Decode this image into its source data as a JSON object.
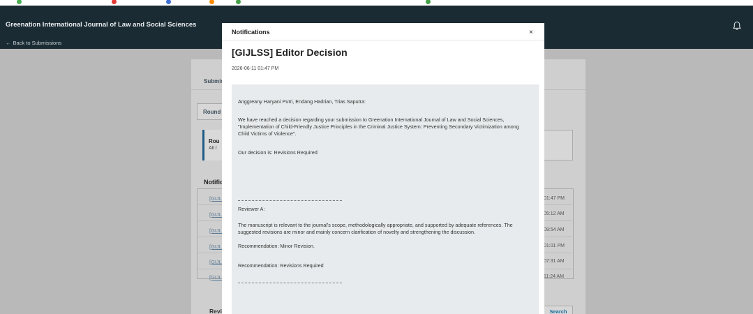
{
  "app": {
    "title": "Greenation International Journal of Law and Social Sciences",
    "back_label": "Back to Submissions"
  },
  "background": {
    "tab_submission": "Submis",
    "tab_round": "Round",
    "notice_title": "Rou",
    "notice_text": "All r",
    "notifications_heading": "Notific",
    "rows": [
      {
        "link": "[GIJLS",
        "time": "01:47 PM"
      },
      {
        "link": "[GIJLS",
        "time": "05:12 AM"
      },
      {
        "link": "[GIJLS",
        "time": "09:54 AM"
      },
      {
        "link": "[GIJLS",
        "time": "01:01 PM"
      },
      {
        "link": "[GIJLS",
        "time": "07:31 AM"
      },
      {
        "link": "[GIJLS",
        "time": "11:24 AM"
      }
    ],
    "reviewers_heading": "Revi",
    "search_label": "Search"
  },
  "modal": {
    "title": "Notifications",
    "close": "×",
    "subject": "[GIJLSS] Editor Decision",
    "date": "2026-06-11 01:47 PM",
    "recipients": "Anggreany Haryani Putri, Endang Hadrian, Trias Saputra:",
    "body_intro": "We have reached a decision regarding your submission to Greenation International Journal of Law and Social Sciences, \"Implementation of Child-Friendly Justice Principles in the Criminal Justice System: Preventing Secondary Victimization among Child Victims of Violence\".",
    "decision": "Our decision is: Revisions Required",
    "reviewer": "Reviewer A:",
    "review_text": "The manuscript is relevant to the journal's scope, methodologically appropriate, and supported by adequate references. The suggested revisions are minor and mainly concern clarification of novelty and strengthening the discussion.",
    "reviewer_recommendation": "Recommendation: Minor Revision.",
    "final_recommendation": "Recommendation: Revisions Required"
  },
  "colors": {
    "header_bg": "#1b2b33",
    "modal_bg": "#ffffff",
    "message_bg": "#e8ebed",
    "link": "#5b7a95"
  }
}
